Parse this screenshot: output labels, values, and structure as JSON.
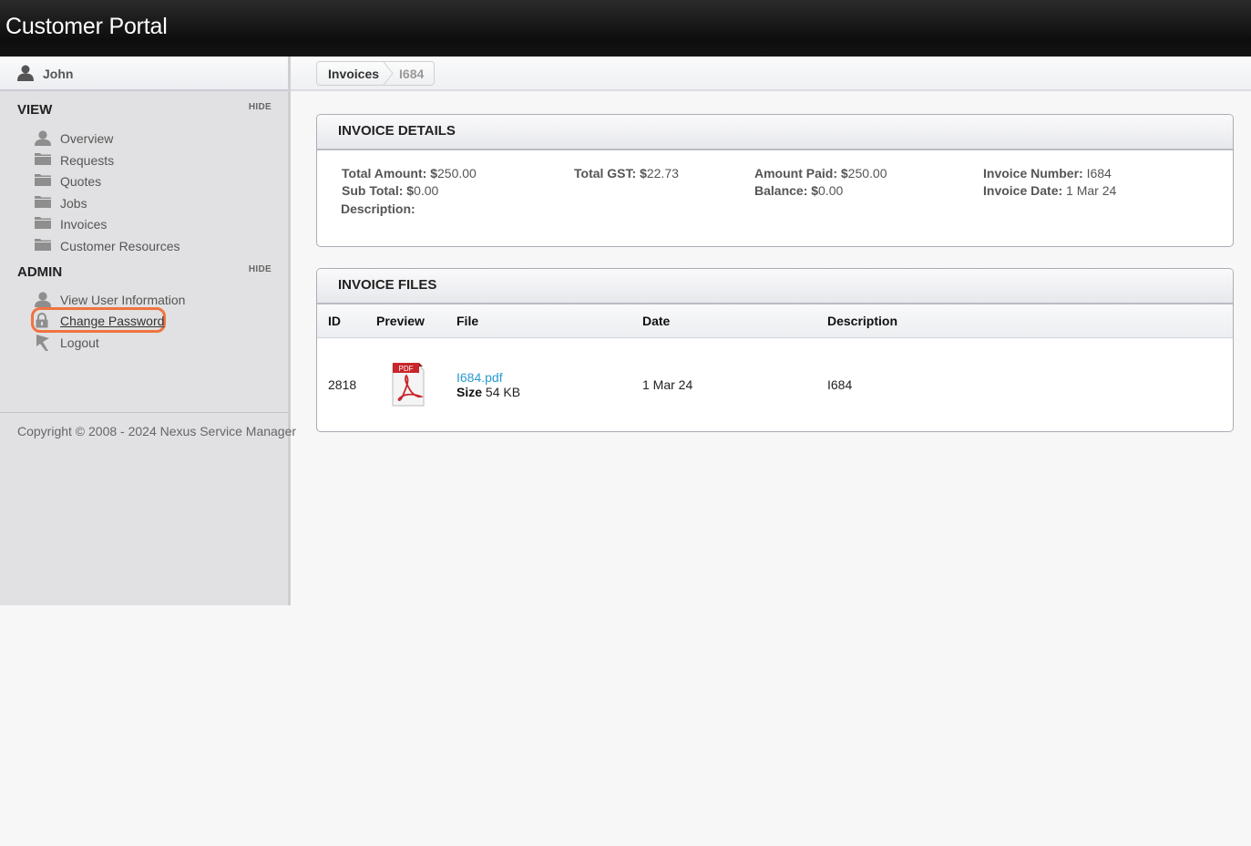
{
  "app": {
    "title": "Customer Portal"
  },
  "user": {
    "name": "John",
    "icon": "user-icon"
  },
  "sidebar": {
    "view": {
      "title": "VIEW",
      "hide_label": "HIDE",
      "items": [
        {
          "label": "Overview",
          "icon": "user-icon"
        },
        {
          "label": "Requests",
          "icon": "folder-icon"
        },
        {
          "label": "Quotes",
          "icon": "folder-icon"
        },
        {
          "label": "Jobs",
          "icon": "folder-icon"
        },
        {
          "label": "Invoices",
          "icon": "folder-icon"
        },
        {
          "label": "Customer Resources",
          "icon": "folder-icon"
        }
      ]
    },
    "admin": {
      "title": "ADMIN",
      "hide_label": "HIDE",
      "items": [
        {
          "label": "View User Information",
          "icon": "user-icon"
        },
        {
          "label": "Change Password",
          "icon": "lock-icon",
          "highlighted": true
        },
        {
          "label": "Logout",
          "icon": "logout-icon"
        }
      ]
    },
    "copyright": "Copyright © 2008 - 2024 Nexus Service Manager"
  },
  "breadcrumb": [
    {
      "label": "Invoices"
    },
    {
      "label": "I684"
    }
  ],
  "invoice_details": {
    "title": "INVOICE DETAILS",
    "fields": {
      "total_amount": {
        "label": "Total Amount: $",
        "value": "250.00"
      },
      "sub_total": {
        "label": "Sub Total: $",
        "value": "0.00"
      },
      "description": {
        "label": "Description:",
        "value": ""
      },
      "total_gst": {
        "label": "Total GST: $",
        "value": "22.73"
      },
      "amount_paid": {
        "label": "Amount Paid: $",
        "value": "250.00"
      },
      "balance": {
        "label": "Balance: $",
        "value": "0.00"
      },
      "invoice_number": {
        "label": "Invoice Number:",
        "value": "I684"
      },
      "invoice_date": {
        "label": "Invoice Date:",
        "value": "1 Mar 24"
      }
    }
  },
  "invoice_files": {
    "title": "INVOICE FILES",
    "columns": [
      "ID",
      "Preview",
      "File",
      "Date",
      "Description"
    ],
    "rows": [
      {
        "id": "2818",
        "preview_icon": "pdf-icon",
        "preview_badge": "PDF",
        "file_name": "I684.pdf",
        "size_label": "Size",
        "size_value": "54 KB",
        "date": "1 Mar 24",
        "description": "I684"
      }
    ]
  },
  "colors": {
    "link": "#2a9ad0",
    "highlight_ring": "#f07340",
    "header_bg": "#111111",
    "sidebar_bg": "#e1e1e3"
  }
}
